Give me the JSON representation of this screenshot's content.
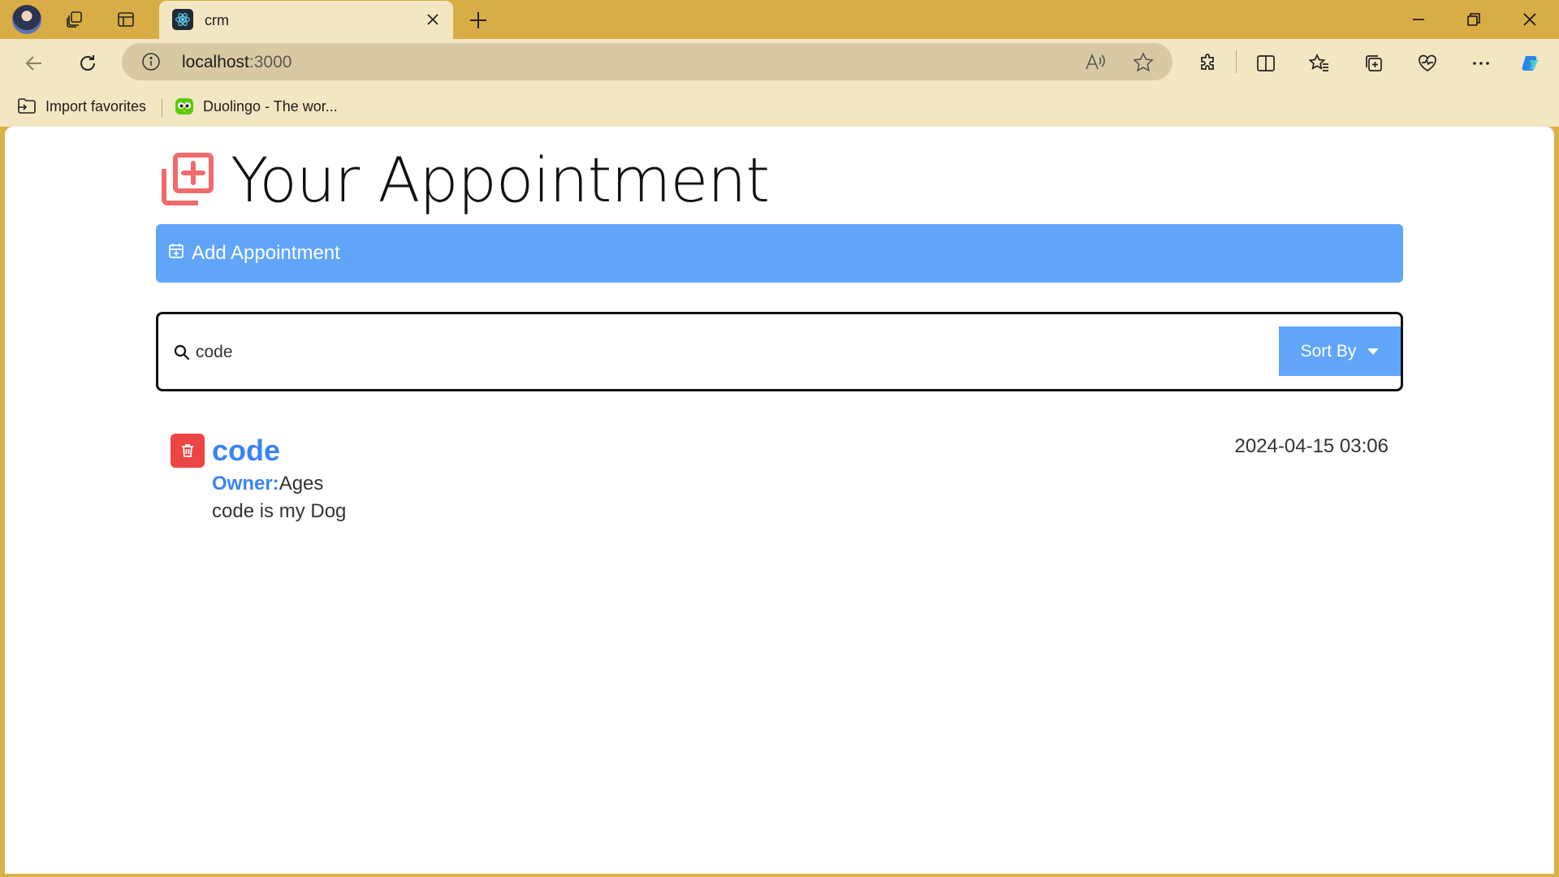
{
  "browser": {
    "tab_title": "crm",
    "url_host": "localhost",
    "url_port": ":3000",
    "favorites": [
      {
        "label": "Import favorites",
        "icon": "folder-import-icon"
      },
      {
        "label": "Duolingo - The wor...",
        "icon": "duolingo-icon"
      }
    ]
  },
  "app": {
    "title": "Your Appointment",
    "add_label": "Add Appointment",
    "search_value": "code",
    "sort_label": "Sort By",
    "accent_color": "#60a5fa",
    "delete_color": "#ef4444",
    "appointments": [
      {
        "pet_name": "code",
        "owner_label": "Owner:",
        "owner_name": "Ages",
        "notes": "code is my Dog",
        "date": "2024-04-15 03:06"
      }
    ]
  }
}
